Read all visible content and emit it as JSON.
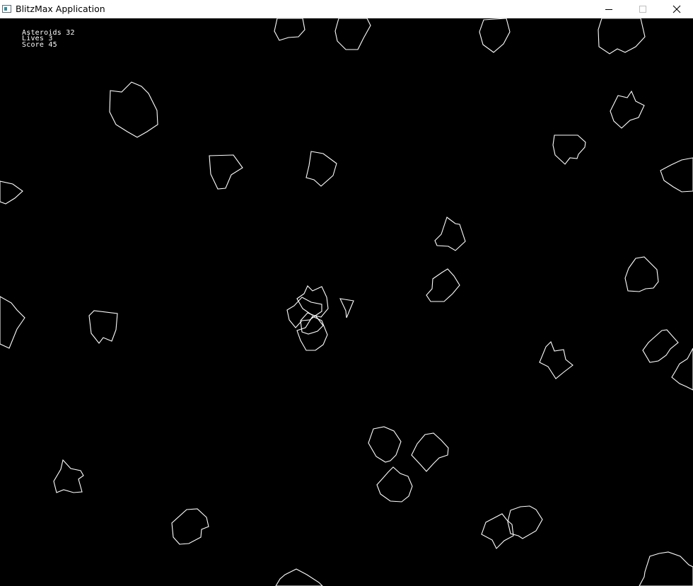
{
  "window": {
    "title": "BlitzMax Application",
    "icon": "app-window-icon",
    "controls": [
      "minimize-icon",
      "maximize-icon",
      "close-icon"
    ]
  },
  "hud": {
    "asteroids_label": "Asteroids",
    "asteroids_count": "32",
    "lives_label": "Lives",
    "lives_count": "3",
    "score_label": "Score",
    "score_value": "45"
  },
  "colors": {
    "background": "#000000",
    "line": "#ffffff",
    "titlebar": "#ffffff"
  }
}
